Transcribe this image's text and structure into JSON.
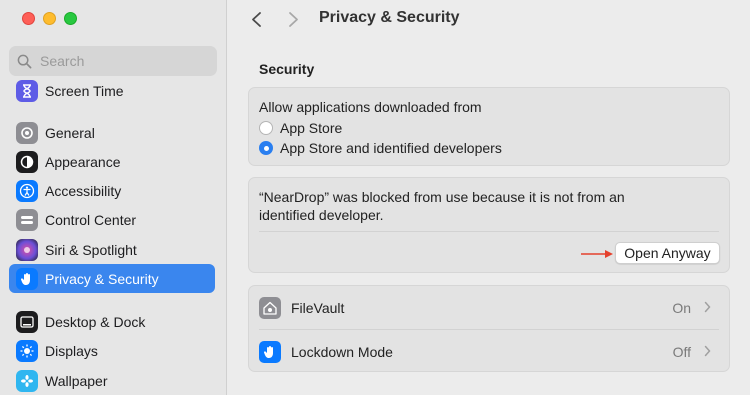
{
  "window": {
    "title": "Privacy & Security"
  },
  "search": {
    "placeholder": "Search"
  },
  "sidebar": {
    "items": [
      {
        "label": "Screen Time",
        "icon": "hourglass-icon",
        "color": "#5e5ce6"
      },
      {
        "label": "General",
        "icon": "gear-icon",
        "color": "#8e8e93"
      },
      {
        "label": "Appearance",
        "icon": "appearance-icon",
        "color": "#1c1c1e"
      },
      {
        "label": "Accessibility",
        "icon": "accessibility-icon",
        "color": "#0a7aff"
      },
      {
        "label": "Control Center",
        "icon": "control-center-icon",
        "color": "#8e8e93"
      },
      {
        "label": "Siri & Spotlight",
        "icon": "siri-icon",
        "color": "#6b4fd8"
      },
      {
        "label": "Privacy & Security",
        "icon": "hand-icon",
        "color": "#0a7aff",
        "active": true
      },
      {
        "label": "Desktop & Dock",
        "icon": "dock-icon",
        "color": "#1c1c1e"
      },
      {
        "label": "Displays",
        "icon": "sun-icon",
        "color": "#0a7aff"
      },
      {
        "label": "Wallpaper",
        "icon": "flower-icon",
        "color": "#2fb6f0"
      }
    ]
  },
  "main": {
    "security_heading": "Security",
    "allow_label": "Allow applications downloaded from",
    "options": [
      {
        "label": "App Store",
        "checked": false
      },
      {
        "label": "App Store and identified developers",
        "checked": true
      }
    ],
    "blocked_message": "“NearDrop” was blocked from use because it is not from an identified developer.",
    "open_anyway_label": "Open Anyway",
    "rows": [
      {
        "label": "FileVault",
        "value": "On",
        "icon": "house-lock-icon"
      },
      {
        "label": "Lockdown Mode",
        "value": "Off",
        "icon": "hand-icon"
      }
    ]
  },
  "colors": {
    "accent": "#3a86ee",
    "arrow": "#e5412d"
  }
}
